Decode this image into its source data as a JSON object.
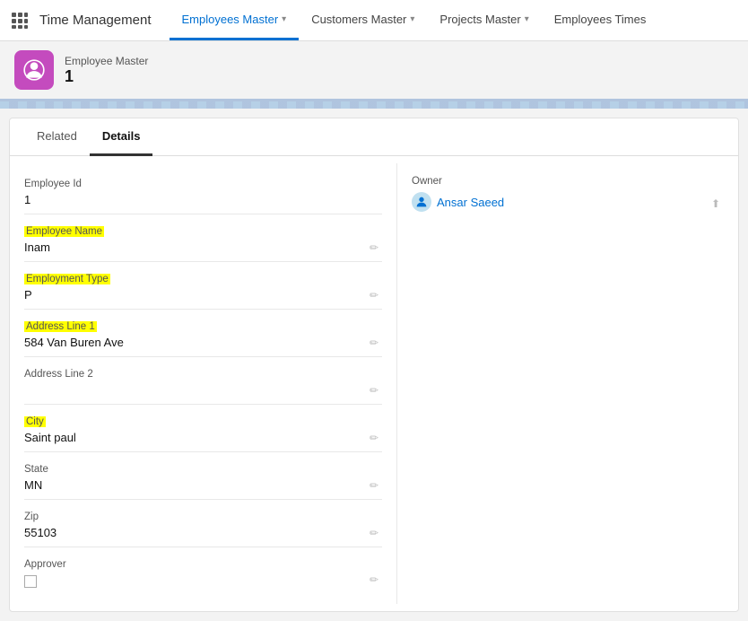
{
  "nav": {
    "app_name": "Time Management",
    "tabs": [
      {
        "label": "Employees Master",
        "active": true,
        "has_chevron": true
      },
      {
        "label": "Customers Master",
        "active": false,
        "has_chevron": true
      },
      {
        "label": "Projects Master",
        "active": false,
        "has_chevron": true
      },
      {
        "label": "Employees Times",
        "active": false,
        "has_chevron": false
      }
    ]
  },
  "page_header": {
    "title": "Employee Master",
    "id": "1"
  },
  "content_tabs": [
    {
      "label": "Related",
      "active": false
    },
    {
      "label": "Details",
      "active": true
    }
  ],
  "fields_left": [
    {
      "label": "Employee Id",
      "value": "1",
      "highlight": false,
      "edit": false
    },
    {
      "label": "Employee Name",
      "value": "Inam",
      "highlight": true,
      "edit": true
    },
    {
      "label": "Employment Type",
      "value": "P",
      "highlight": true,
      "edit": true
    },
    {
      "label": "Address Line 1",
      "value": "584 Van Buren Ave",
      "highlight": true,
      "edit": true
    },
    {
      "label": "Address Line 2",
      "value": "",
      "highlight": false,
      "edit": true
    },
    {
      "label": "City",
      "value": "Saint paul",
      "highlight": true,
      "edit": true
    },
    {
      "label": "State",
      "value": "MN",
      "highlight": false,
      "edit": true
    },
    {
      "label": "Zip",
      "value": "55103",
      "highlight": false,
      "edit": true
    },
    {
      "label": "Approver",
      "value": "",
      "highlight": false,
      "edit": true,
      "type": "checkbox"
    }
  ],
  "owner": {
    "label": "Owner",
    "name": "Ansar Saeed"
  },
  "icons": {
    "grid": "⠿",
    "edit": "✏",
    "chevron": "▾",
    "person": "👤",
    "upload": "⬆"
  }
}
